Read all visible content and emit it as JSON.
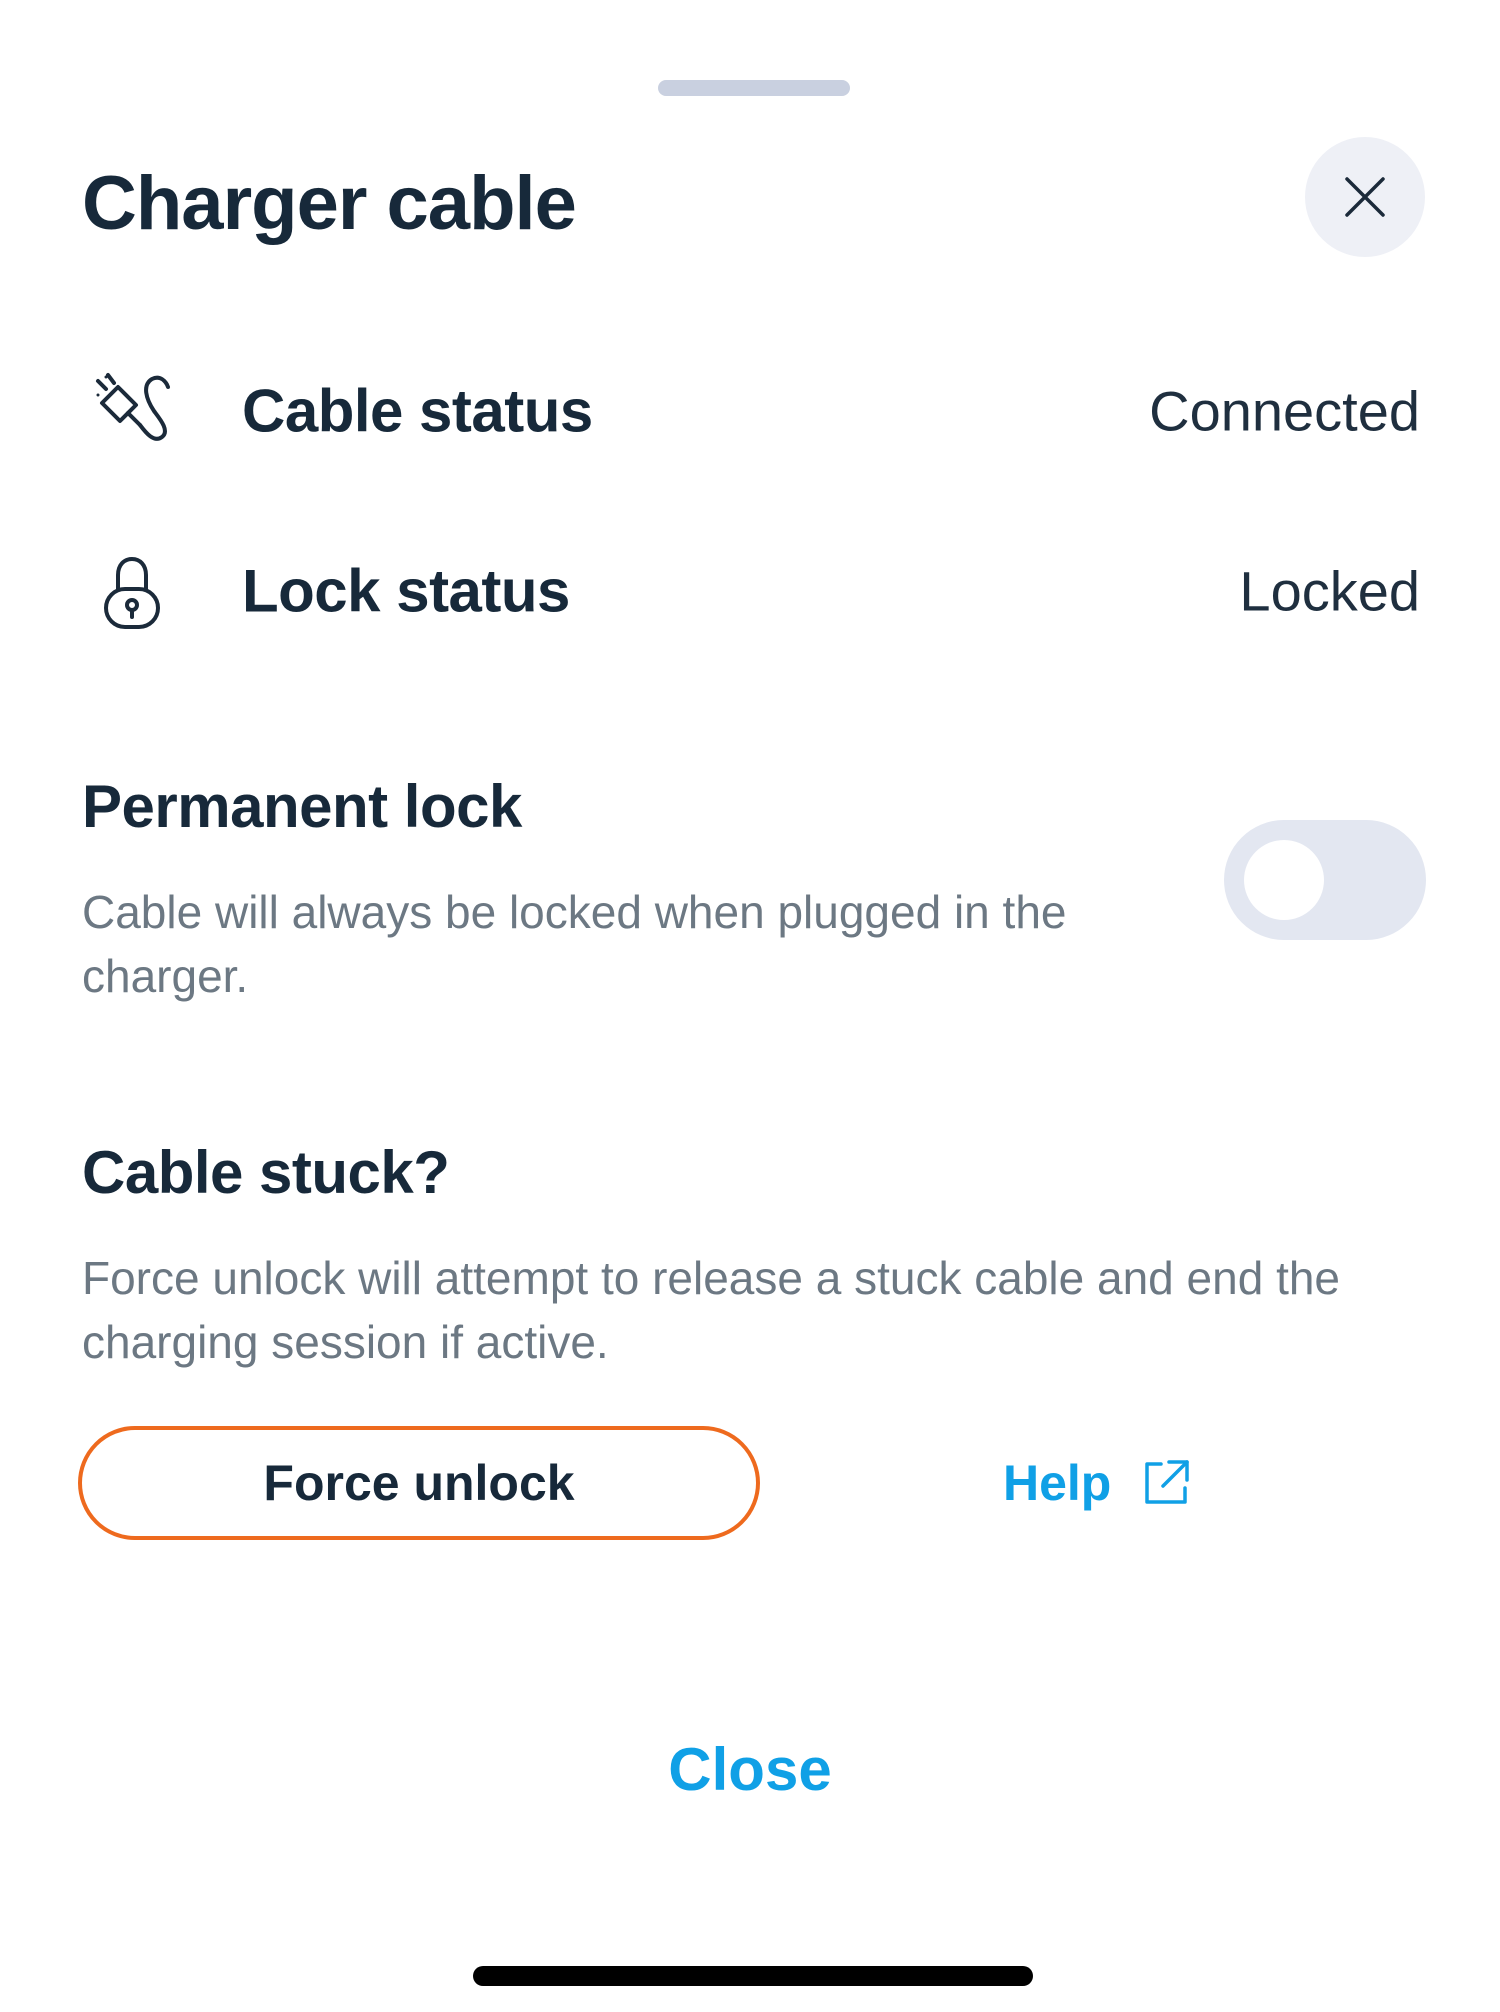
{
  "sheet": {
    "title": "Charger cable",
    "close_icon": "close-icon"
  },
  "status_rows": [
    {
      "icon": "cable-plug-icon",
      "label": "Cable status",
      "value": "Connected"
    },
    {
      "icon": "padlock-icon",
      "label": "Lock status",
      "value": "Locked"
    }
  ],
  "permanent_lock": {
    "heading": "Permanent lock",
    "description": "Cable will always be locked when plugged in the charger.",
    "enabled": false
  },
  "cable_stuck": {
    "heading": "Cable stuck?",
    "description": "Force unlock will attempt to release a stuck cable and end the charging session if active.",
    "force_unlock_label": "Force unlock",
    "help_label": "Help",
    "help_icon": "external-link-icon"
  },
  "footer": {
    "close_label": "Close"
  },
  "colors": {
    "accent_blue": "#10a0e6",
    "force_unlock_border": "#ee6a1e",
    "toggle_off_track": "#e3e7f1",
    "heading_text": "#17293a",
    "secondary_text": "#6c7883"
  }
}
